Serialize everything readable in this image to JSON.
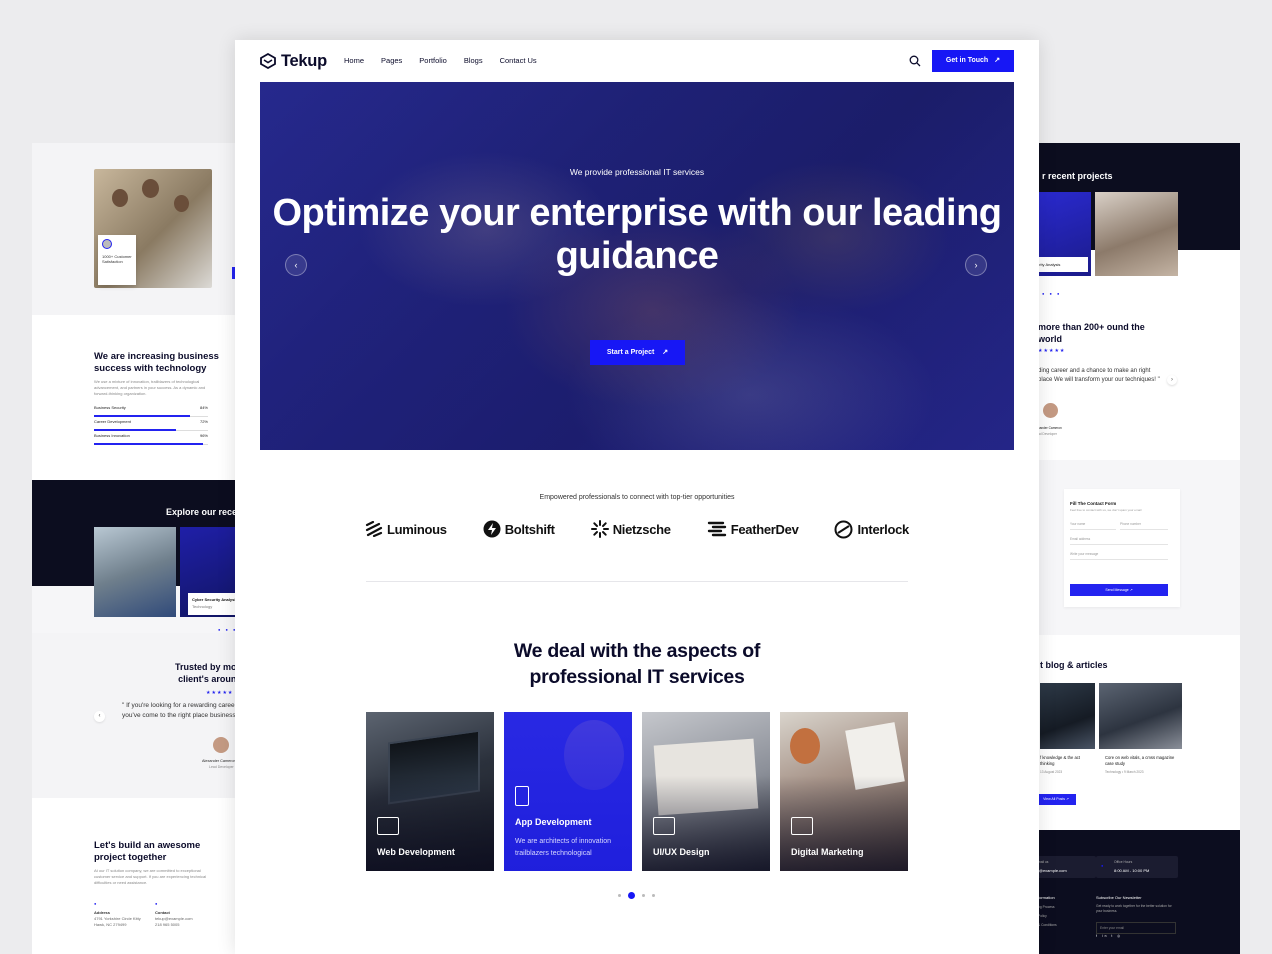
{
  "left_page": {
    "badge": "1000+ Customer Satisfaction",
    "increasing": {
      "title": "We are increasing business success with technology",
      "text": "We use a mixture of innovation, trailblazers of technological advancement, and partners in your success. As a dynamic and forward-thinking organization.",
      "skills": [
        {
          "label": "Business Security",
          "value": "84%",
          "pct": 84
        },
        {
          "label": "Career Development",
          "value": "72%",
          "pct": 72
        },
        {
          "label": "Business Innovation",
          "value": "96%",
          "pct": 96
        }
      ]
    },
    "recent_title": "Explore our recent",
    "project_card": {
      "title": "Cyber Security Analysis",
      "category": "Technology"
    },
    "trusted_title": "Trusted by more client's around",
    "quote": "\" If you're looking for a rewarding career impact, you've come to the right place business through our",
    "author_name": "Alexander Cameron",
    "author_role": "Lead Developer",
    "contact_title": "Let's build an awesome project together",
    "contact_text": "At our IT solution company, we are committed to exceptional customer service and support. If you are experiencing technical difficulties or need assistance.",
    "address_label": "Address",
    "address_value": "4791 Yorkshire Circle Kitty Hawk, NC 279499",
    "contact_label": "Contact",
    "contact_email": "tekup@example.com",
    "contact_phone": "218 965 5005"
  },
  "right_page": {
    "projects_title": "r recent projects",
    "project_label": "urity Analysis",
    "trusted_title": "more than 200+ ound the world",
    "quote": "ding career and a chance to make an right place We will transform your our techniques! \"",
    "author_name": "xander Cameron",
    "author_role": "ad Developer",
    "form_title": "Fill The Contact Form",
    "form_sub": "Feel free to contact with us, we don't spam your email",
    "field_name": "Your name",
    "field_phone": "Phone number",
    "field_email": "Email address",
    "field_message": "Write your message",
    "send_label": "Send Message",
    "blog_title": "t blog & articles",
    "blog1_title": "f knowledge & the act thinking",
    "blog1_meta": "13 August 2023",
    "blog2_title": "Core on web vitals, a cmss magazine case study",
    "blog2_meta": "Technology  •  9 March 2023",
    "view_all": "View All Posts",
    "email_label": "mail us",
    "email_value": "l@example.com",
    "office_label": "Office Hours",
    "office_value": "8:00 AM - 10:00 PM",
    "info_title": "formation",
    "info_links": [
      "ng Process",
      "Policy",
      "& Conditions"
    ],
    "newsletter_title": "Subscribe Our Newsletter",
    "newsletter_text": "Get ready to work together for the better solution for your business.",
    "newsletter_placeholder": "Enter your email"
  },
  "main": {
    "logo": "Tekup",
    "nav": [
      "Home",
      "Pages",
      "Portfolio",
      "Blogs",
      "Contact Us"
    ],
    "cta": "Get in Touch",
    "hero": {
      "subtitle": "We provide professional IT services",
      "title": "Optimize your enterprise with our leading guidance",
      "button": "Start a Project"
    },
    "brands_caption": "Empowered professionals to connect with top-tier opportunities",
    "brands": [
      "Luminous",
      "Boltshift",
      "Nietzsche",
      "FeatherDev",
      "Interlock"
    ],
    "services_title": "We deal with the aspects of professional IT services",
    "services": [
      {
        "label": "Web Development"
      },
      {
        "label": "App Development",
        "desc": "We are architects of innovation trailblazers technological"
      },
      {
        "label": "UI/UX Design"
      },
      {
        "label": "Digital Marketing"
      }
    ]
  },
  "colors": {
    "accent": "#1717f5",
    "dark": "#0c0d1f",
    "text": "#0b0b2a"
  }
}
